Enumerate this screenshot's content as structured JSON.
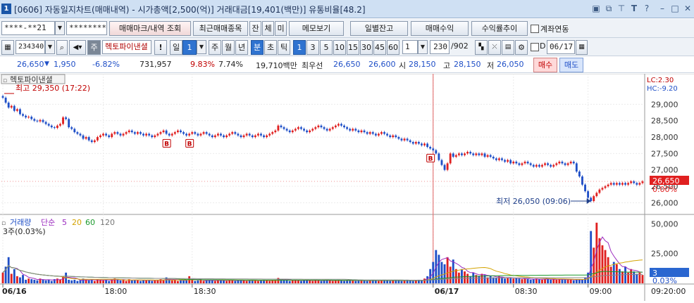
{
  "titlebar": {
    "screen_no": "1",
    "title": "[0606] 자동일지차트(매매내역) - 시가총액[2,500(억)] 거래대금[19,401(백만)] 유통비율[48.2]",
    "icons": [
      "window-icon",
      "link-icon",
      "pin-icon",
      "font-icon",
      "help-icon",
      "minimize-icon",
      "maximize-icon",
      "close-icon"
    ]
  },
  "toolbar1": {
    "account": "****-**21",
    "password": "********",
    "btn_markers": "매매마크/내역 조회",
    "btn_recent": "최근매매종목",
    "btn_jan": "잔",
    "btn_che": "체",
    "btn_mi": "미",
    "btn_memo": "메모보기",
    "btn_daily": "일별잔고",
    "btn_profit": "매매수익",
    "btn_rate": "수익률추이",
    "chk_account_link": "계좌연동"
  },
  "toolbar2": {
    "code": "234340",
    "market_badge": "주",
    "stock_name": "헥토파이낸셜",
    "alert": "!",
    "period_label": "일",
    "period_value": "1",
    "periods": [
      "주",
      "월",
      "년",
      "분",
      "초",
      "틱"
    ],
    "active_period": "분",
    "minute_options": [
      "1",
      "3",
      "5",
      "10",
      "15",
      "30",
      "45",
      "60"
    ],
    "active_minute": "1",
    "count_value": "1",
    "data_count": "230",
    "data_total": "/902",
    "date_value": "06/17",
    "chk_d": "D"
  },
  "quote": {
    "price": "26,650",
    "change": "1,950",
    "change_pct": "-6.82%",
    "volume": "731,957",
    "vol_ratio": "9.83%",
    "turnover": "7.74%",
    "amount": "19,710백만",
    "priority_label": "최우선",
    "ask": "26,650",
    "bid": "26,600",
    "open_label": "시",
    "open": "28,150",
    "high_label": "고",
    "high": "28,150",
    "low_label": "저",
    "low": "26,050",
    "buy_btn": "매수",
    "sell_btn": "매도"
  },
  "colors": {
    "up": "#e02020",
    "down": "#1f4fc7",
    "price_tag": "#e02020",
    "vol_tag": "#2a66d0"
  },
  "chart_labels": {
    "stock": "헥토파이낸셜",
    "high_marker": "최고 29,350 (17:22)",
    "low_marker": "최저 26,050 (09:06)",
    "lc": "LC:2.30",
    "hc": "HC:-9.20",
    "price_tag": "26,650",
    "price_pct": "0.00%",
    "vol_legend_title": "거래량",
    "vol_legend_ma": "단순",
    "vol_legend_p1": "5",
    "vol_legend_p2": "20",
    "vol_legend_p3": "60",
    "vol_legend_p4": "120",
    "vol_sub": "3주(0.03%)",
    "vol_tag": "3",
    "vol_pct": "0.03%",
    "buy_mark": "B"
  },
  "chart_data": {
    "type": "candlestick",
    "price_axis": {
      "ticks": [
        29000,
        28500,
        28000,
        27500,
        27000,
        26500,
        26000
      ],
      "ylim": [
        25750,
        29500
      ]
    },
    "volume_axis": {
      "ticks": [
        "50,000",
        "25,000"
      ],
      "ylim": [
        0,
        55000
      ]
    },
    "x_labels": [
      "06/16",
      "18:00",
      "18:30",
      "06/17",
      "08:30",
      "09:00",
      "09:20:00"
    ],
    "x_label_index": [
      0,
      35,
      66,
      150,
      178,
      204,
      250
    ],
    "day_break_index": 150,
    "buy_marks_index": [
      57,
      65,
      149
    ],
    "high": {
      "value": 29350,
      "time": "17:22"
    },
    "low": {
      "value": 26050,
      "time": "09:06"
    },
    "last_price": 26650,
    "close_series": [
      29200,
      29050,
      28900,
      28950,
      28800,
      28850,
      28700,
      28650,
      28600,
      28620,
      28550,
      28500,
      28480,
      28520,
      28460,
      28400,
      28350,
      28300,
      28280,
      28350,
      28400,
      28600,
      28550,
      28300,
      28250,
      28150,
      28100,
      28050,
      27950,
      28000,
      27900,
      27850,
      27900,
      28000,
      28050,
      28100,
      28050,
      28000,
      28100,
      28150,
      28100,
      28050,
      28100,
      28150,
      28200,
      28150,
      28100,
      28150,
      28100,
      28050,
      28100,
      28050,
      28000,
      28050,
      28100,
      28150,
      28200,
      28100,
      28050,
      28100,
      28150,
      28200,
      28150,
      28100,
      28050,
      28100,
      28150,
      28100,
      28050,
      28100,
      28150,
      28100,
      28050,
      28000,
      28050,
      28100,
      28050,
      28000,
      28050,
      28100,
      28150,
      28100,
      28050,
      28000,
      28050,
      28100,
      28050,
      28000,
      28050,
      28100,
      28050,
      28000,
      28050,
      28100,
      28150,
      28200,
      28350,
      28300,
      28250,
      28200,
      28150,
      28200,
      28250,
      28300,
      28250,
      28200,
      28150,
      28200,
      28250,
      28300,
      28350,
      28300,
      28250,
      28200,
      28250,
      28300,
      28350,
      28400,
      28350,
      28300,
      28250,
      28200,
      28250,
      28200,
      28150,
      28200,
      28150,
      28100,
      28150,
      28100,
      28050,
      28100,
      28150,
      28100,
      28050,
      28000,
      28050,
      28000,
      27950,
      27900,
      27950,
      27900,
      27850,
      27800,
      27850,
      27800,
      27750,
      27800,
      27700,
      27650,
      27600,
      27500,
      27300,
      27150,
      27000,
      27200,
      27500,
      27400,
      27450,
      27500,
      27450,
      27500,
      27550,
      27500,
      27450,
      27500,
      27450,
      27500,
      27400,
      27450,
      27400,
      27350,
      27300,
      27350,
      27300,
      27250,
      27300,
      27200,
      27250,
      27200,
      27150,
      27200,
      27250,
      27200,
      27150,
      27100,
      27150,
      27100,
      27150,
      27200,
      27150,
      27100,
      27150,
      27200,
      27250,
      27200,
      27150,
      27200,
      27250,
      27200,
      26950,
      26800,
      26550,
      26350,
      26150,
      26050,
      26200,
      26300,
      26400,
      26450,
      26500,
      26550,
      26600,
      26550,
      26600,
      26550,
      26600,
      26550,
      26600,
      26650,
      26600,
      26550,
      26600,
      26650
    ],
    "volume_series": [
      9000,
      14000,
      22000,
      8000,
      12000,
      6000,
      5000,
      7000,
      3000,
      4000,
      3500,
      3000,
      2500,
      4000,
      3000,
      2500,
      3000,
      2000,
      3500,
      4000,
      3000,
      6000,
      9000,
      3000,
      2500,
      3000,
      2000,
      2500,
      4000,
      3000,
      2500,
      3000,
      2000,
      3500,
      3000,
      2500,
      3000,
      2000,
      3500,
      4000,
      3000,
      2500,
      3000,
      2000,
      3500,
      2500,
      3000,
      2500,
      2000,
      3000,
      2500,
      3000,
      2000,
      2500,
      3000,
      3500,
      2500,
      5000,
      3000,
      2500,
      3000,
      2000,
      2500,
      3000,
      2500,
      6000,
      3000,
      2000,
      2500,
      3000,
      2000,
      2500,
      3000,
      2500,
      2000,
      2500,
      3000,
      2500,
      2000,
      3000,
      2500,
      2000,
      2500,
      3000,
      2500,
      2000,
      2500,
      3000,
      2500,
      2000,
      2500,
      3000,
      2500,
      2000,
      2500,
      3000,
      4500,
      3000,
      2500,
      3000,
      2000,
      2500,
      3000,
      2500,
      2000,
      2500,
      3000,
      2500,
      2000,
      3000,
      2500,
      2000,
      2500,
      3000,
      2500,
      2000,
      2500,
      3000,
      2500,
      2000,
      2500,
      3000,
      2500,
      2000,
      2500,
      3000,
      2500,
      2000,
      2500,
      3000,
      2500,
      2000,
      2500,
      3000,
      2500,
      2000,
      2500,
      3000,
      2500,
      2000,
      2500,
      3000,
      2500,
      2000,
      2500,
      3000,
      2500,
      4000,
      6000,
      12000,
      18000,
      28000,
      24000,
      18000,
      16000,
      22000,
      14000,
      20000,
      12000,
      9000,
      12000,
      10000,
      8000,
      6000,
      9000,
      7000,
      6000,
      8000,
      7000,
      5000,
      6000,
      5000,
      4500,
      6000,
      5000,
      4000,
      4500,
      5000,
      4000,
      4500,
      4000,
      3500,
      4000,
      3500,
      3000,
      3500,
      4000,
      3500,
      3000,
      3500,
      4000,
      3000,
      3500,
      3000,
      3500,
      3000,
      3500,
      3000,
      3000,
      2500,
      3000,
      3500,
      3000,
      4500,
      9000,
      44000,
      30000,
      51000,
      38000,
      32000,
      28000,
      22000,
      14000,
      18000,
      16000,
      12000,
      10000,
      14000,
      9000,
      12000,
      10000,
      8000,
      9000,
      7000,
      8000,
      10000,
      9000,
      7000,
      6000
    ]
  }
}
